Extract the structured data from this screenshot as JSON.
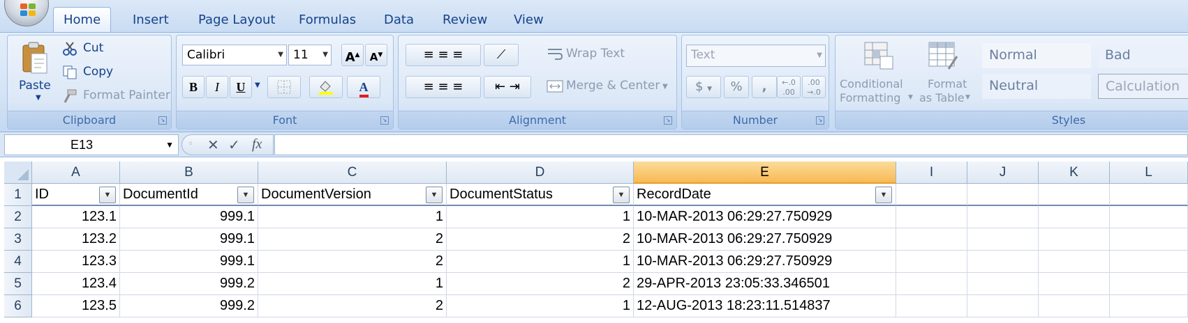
{
  "tabs": [
    "Home",
    "Insert",
    "Page Layout",
    "Formulas",
    "Data",
    "Review",
    "View"
  ],
  "clipboard": {
    "paste": "Paste",
    "cut": "Cut",
    "copy": "Copy",
    "format_painter": "Format Painter",
    "label": "Clipboard"
  },
  "font": {
    "name": "Calibri",
    "size": "11",
    "grow": "A",
    "shrink": "A",
    "bold": "B",
    "italic": "I",
    "underline": "U",
    "font_color_letter": "A",
    "label": "Font"
  },
  "alignment": {
    "wrap_text": "Wrap Text",
    "merge_center": "Merge & Center",
    "label": "Alignment"
  },
  "number": {
    "format": "Text",
    "currency": "$",
    "percent": "%",
    "comma": ",",
    "label": "Number"
  },
  "styles": {
    "conditional_line1": "Conditional",
    "conditional_line2": "Formatting",
    "format_table_line1": "Format",
    "format_table_line2": "as Table",
    "normal": "Normal",
    "bad": "Bad",
    "neutral": "Neutral",
    "calculation": "Calculation",
    "label": "Styles"
  },
  "formula_bar": {
    "name_box": "E13",
    "fx": "fx",
    "content": ""
  },
  "columns": [
    "A",
    "B",
    "C",
    "D",
    "E",
    "I",
    "J",
    "K",
    "L"
  ],
  "rows": [
    "1",
    "2",
    "3",
    "4",
    "5",
    "6"
  ],
  "table": {
    "headers": [
      "ID",
      "DocumentId",
      "DocumentVersion",
      "DocumentStatus",
      "RecordDate"
    ],
    "data": [
      [
        "123.1",
        "999.1",
        "1",
        "1",
        "10-MAR-2013 06:29:27.750929"
      ],
      [
        "123.2",
        "999.1",
        "2",
        "2",
        "10-MAR-2013 06:29:27.750929"
      ],
      [
        "123.3",
        "999.1",
        "2",
        "1",
        "10-MAR-2013 06:29:27.750929"
      ],
      [
        "123.4",
        "999.2",
        "1",
        "2",
        "29-APR-2013 23:05:33.346501"
      ],
      [
        "123.5",
        "999.2",
        "2",
        "1",
        "12-AUG-2013 18:23:11.514837"
      ]
    ]
  },
  "colors": {
    "selected_column": "#f8b955",
    "ribbon_text": "#15428b",
    "font_color_bar": "#e41b1b"
  }
}
